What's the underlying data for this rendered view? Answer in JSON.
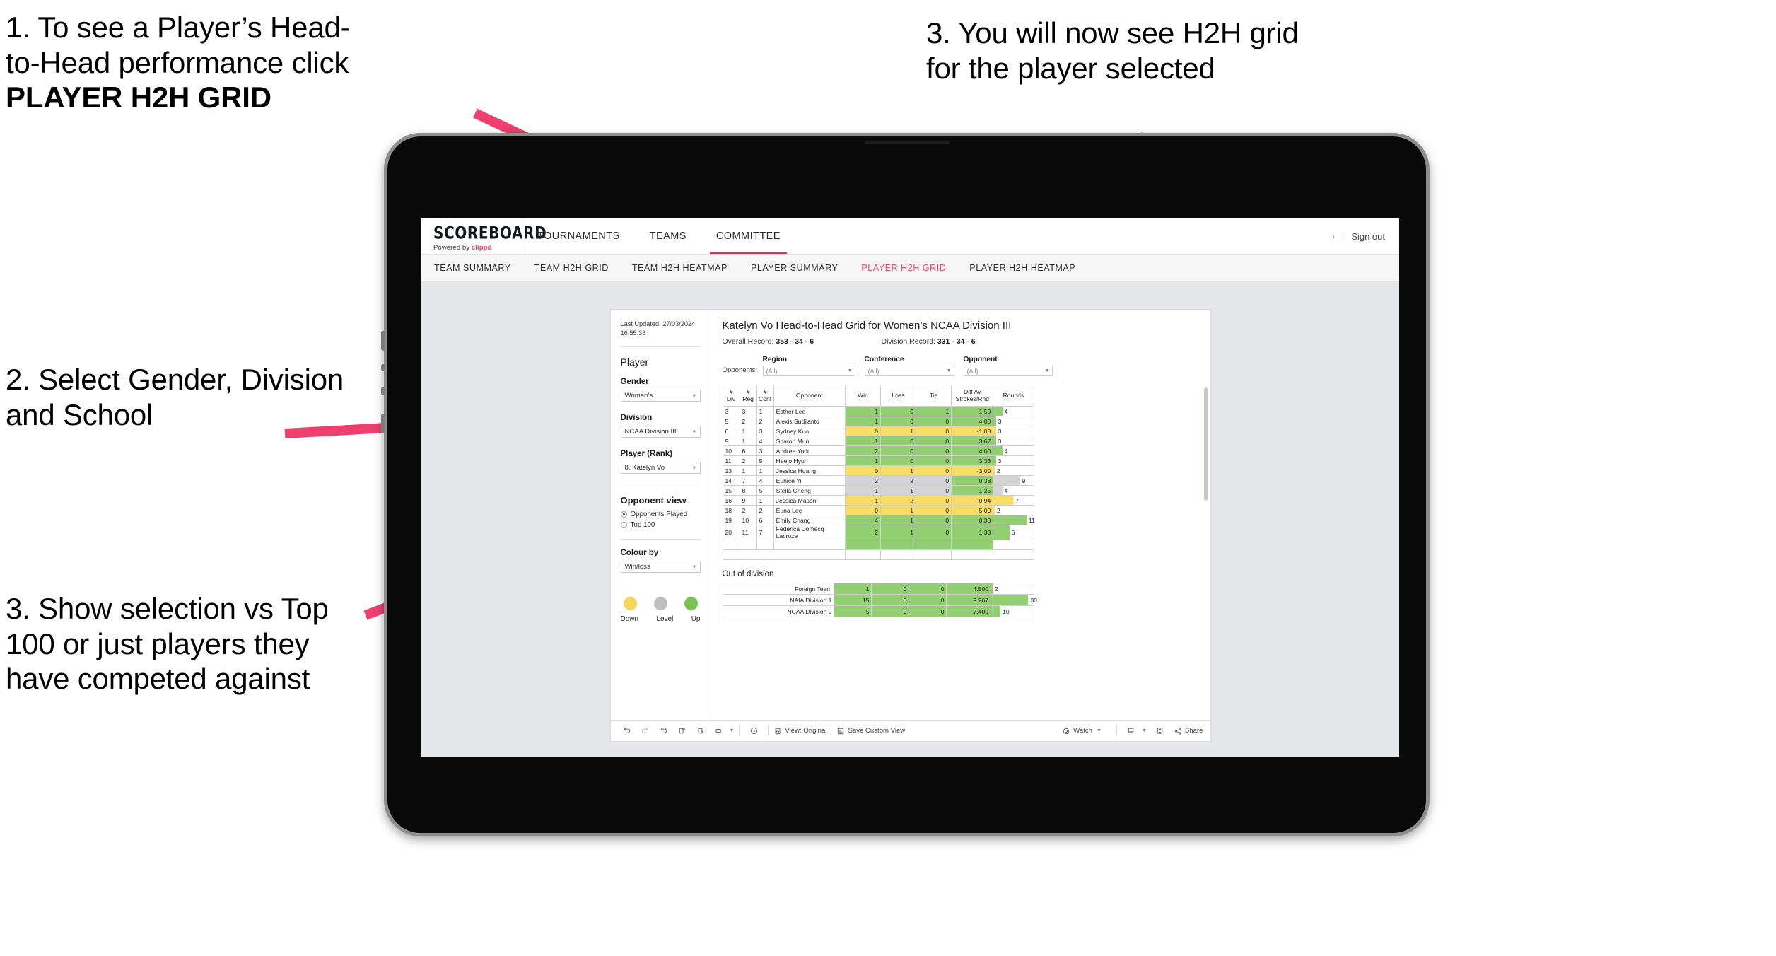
{
  "annotations": [
    {
      "id": "anno-1",
      "line1": "1. To see a Player’s Head-",
      "line2": "to-Head performance click",
      "bold": "PLAYER H2H GRID"
    },
    {
      "id": "anno-3r",
      "line1": "3. You will now see H2H grid",
      "line2": "for the player selected"
    },
    {
      "id": "anno-2",
      "text": "2. Select Gender, Division and School"
    },
    {
      "id": "anno-3l",
      "text": "3. Show selection vs Top 100 or just players they have competed against"
    }
  ],
  "accent": "#e8486e",
  "brand": {
    "word": "SCOREBOARD",
    "powered_prefix": "Powered by ",
    "powered_name": "clippd"
  },
  "topnav": {
    "items": [
      {
        "label": "TOURNAMENTS",
        "active": false
      },
      {
        "label": "TEAMS",
        "active": false
      },
      {
        "label": "COMMITTEE",
        "active": true
      }
    ],
    "chevron": "›",
    "separator": "|",
    "signout": "Sign out"
  },
  "subnav": {
    "tabs": [
      {
        "label": "TEAM SUMMARY",
        "active": false
      },
      {
        "label": "TEAM H2H GRID",
        "active": false
      },
      {
        "label": "TEAM H2H HEATMAP",
        "active": false
      },
      {
        "label": "PLAYER SUMMARY",
        "active": false
      },
      {
        "label": "PLAYER H2H GRID",
        "active": true
      },
      {
        "label": "PLAYER H2H HEATMAP",
        "active": false
      }
    ]
  },
  "panel": {
    "last_updated": "Last Updated: 27/03/2024 16:55:38",
    "heading": "Player",
    "fields": [
      {
        "label": "Gender",
        "value": "Women’s"
      },
      {
        "label": "Division",
        "value": "NCAA Division III"
      },
      {
        "label": "Player (Rank)",
        "value": "8. Katelyn Vo"
      }
    ],
    "opponent_view": {
      "heading": "Opponent view",
      "options": [
        {
          "label": "Opponents Played",
          "selected": true
        },
        {
          "label": "Top 100",
          "selected": false
        }
      ]
    },
    "colour_by": {
      "label": "Colour by",
      "value": "Win/loss"
    },
    "legend": [
      {
        "label": "Down",
        "color": "#f4d75e"
      },
      {
        "label": "Level",
        "color": "#bfbfbf"
      },
      {
        "label": "Up",
        "color": "#79c352"
      }
    ]
  },
  "report": {
    "title": "Katelyn Vo Head-to-Head Grid for Women’s NCAA Division III",
    "overall_record_label": "Overall Record: ",
    "overall_record_value": "353 - 34 - 6",
    "division_record_label": "Division Record: ",
    "division_record_value": "331 - 34 - 6",
    "opponents_label": "Opponents:",
    "filters": [
      {
        "caption": "Region",
        "value": "(All)"
      },
      {
        "caption": "Conference",
        "value": "(All)"
      },
      {
        "caption": "Opponent",
        "value": "(All)"
      }
    ],
    "columns": [
      {
        "l1": "#",
        "l2": "Div"
      },
      {
        "l1": "#",
        "l2": "Reg"
      },
      {
        "l1": "#",
        "l2": "Conf"
      },
      {
        "l1": "Opponent",
        "l2": ""
      },
      {
        "l1": "Win",
        "l2": ""
      },
      {
        "l1": "Loss",
        "l2": ""
      },
      {
        "l1": "Tie",
        "l2": ""
      },
      {
        "l1": "Diff Av",
        "l2": "Strokes/Rnd"
      },
      {
        "l1": "Rounds",
        "l2": ""
      }
    ],
    "out_of_division_heading": "Out of division"
  },
  "chart_data": {
    "type": "table",
    "title": "Katelyn Vo Head-to-Head Grid for Women’s NCAA Division III",
    "colors": {
      "up": "#93d072",
      "down": "#f7dd62",
      "level": "#d4d4d4"
    },
    "rows": [
      {
        "div": "3",
        "reg": "3",
        "conf": "1",
        "opponent": "Esther Lee",
        "win": "1",
        "loss": "0",
        "tie": "1",
        "diff": "1.50",
        "rounds": "4",
        "state": "up",
        "diff_state": "up",
        "bar_pct": 22
      },
      {
        "div": "5",
        "reg": "2",
        "conf": "2",
        "opponent": "Alexis Sudjianto",
        "win": "1",
        "loss": "0",
        "tie": "0",
        "diff": "4.00",
        "rounds": "3",
        "state": "up",
        "diff_state": "up",
        "bar_pct": 6
      },
      {
        "div": "6",
        "reg": "1",
        "conf": "3",
        "opponent": "Sydney Kuo",
        "win": "0",
        "loss": "1",
        "tie": "0",
        "diff": "-1.00",
        "rounds": "3",
        "state": "down",
        "diff_state": "down",
        "bar_pct": 6
      },
      {
        "div": "9",
        "reg": "1",
        "conf": "4",
        "opponent": "Sharon Mun",
        "win": "1",
        "loss": "0",
        "tie": "0",
        "diff": "3.67",
        "rounds": "3",
        "state": "up",
        "diff_state": "up",
        "bar_pct": 6
      },
      {
        "div": "10",
        "reg": "6",
        "conf": "3",
        "opponent": "Andrea York",
        "win": "2",
        "loss": "0",
        "tie": "0",
        "diff": "4.00",
        "rounds": "4",
        "state": "up",
        "diff_state": "up",
        "bar_pct": 22
      },
      {
        "div": "11",
        "reg": "2",
        "conf": "5",
        "opponent": "Heejo Hyun",
        "win": "1",
        "loss": "0",
        "tie": "0",
        "diff": "3.33",
        "rounds": "3",
        "state": "up",
        "diff_state": "up",
        "bar_pct": 6
      },
      {
        "div": "13",
        "reg": "1",
        "conf": "1",
        "opponent": "Jessica Huang",
        "win": "0",
        "loss": "1",
        "tie": "0",
        "diff": "-3.00",
        "rounds": "2",
        "state": "down",
        "diff_state": "down",
        "bar_pct": 3
      },
      {
        "div": "14",
        "reg": "7",
        "conf": "4",
        "opponent": "Eunice Yi",
        "win": "2",
        "loss": "2",
        "tie": "0",
        "diff": "0.38",
        "rounds": "9",
        "state": "level",
        "diff_state": "up",
        "bar_pct": 66
      },
      {
        "div": "15",
        "reg": "8",
        "conf": "5",
        "opponent": "Stella Cheng",
        "win": "1",
        "loss": "1",
        "tie": "0",
        "diff": "1.25",
        "rounds": "4",
        "state": "level",
        "diff_state": "up",
        "bar_pct": 22
      },
      {
        "div": "16",
        "reg": "9",
        "conf": "1",
        "opponent": "Jessica Mason",
        "win": "1",
        "loss": "2",
        "tie": "0",
        "diff": "-0.94",
        "rounds": "7",
        "state": "down",
        "diff_state": "down",
        "bar_pct": 50
      },
      {
        "div": "18",
        "reg": "2",
        "conf": "2",
        "opponent": "Euna Lee",
        "win": "0",
        "loss": "1",
        "tie": "0",
        "diff": "-5.00",
        "rounds": "2",
        "state": "down",
        "diff_state": "down",
        "bar_pct": 3
      },
      {
        "div": "19",
        "reg": "10",
        "conf": "6",
        "opponent": "Emily Chang",
        "win": "4",
        "loss": "1",
        "tie": "0",
        "diff": "0.30",
        "rounds": "11",
        "state": "up",
        "diff_state": "up",
        "bar_pct": 83
      },
      {
        "div": "20",
        "reg": "11",
        "conf": "7",
        "opponent": "Federica Domecq Lacroze",
        "win": "2",
        "loss": "1",
        "tie": "0",
        "diff": "1.33",
        "rounds": "6",
        "state": "up",
        "diff_state": "up",
        "bar_pct": 40
      }
    ],
    "out_of_division": [
      {
        "name": "Foreign Team",
        "win": "1",
        "loss": "0",
        "tie": "0",
        "diff": "4.500",
        "rounds": "2",
        "state": "up",
        "bar_pct": 3
      },
      {
        "name": "NAIA Division 1",
        "win": "15",
        "loss": "0",
        "tie": "0",
        "diff": "9.267",
        "rounds": "30",
        "state": "up",
        "bar_pct": 88
      },
      {
        "name": "NCAA Division 2",
        "win": "5",
        "loss": "0",
        "tie": "0",
        "diff": "7.400",
        "rounds": "10",
        "state": "up",
        "bar_pct": 22
      }
    ]
  },
  "toolbar": {
    "icons": [
      "undo-icon",
      "redo-icon",
      "revert-icon",
      "refresh-icon",
      "pause-icon",
      "device-layout-icon"
    ],
    "view_label": "View: Original",
    "save_label": "Save Custom View",
    "watch_label": "Watch",
    "share_label": "Share"
  }
}
